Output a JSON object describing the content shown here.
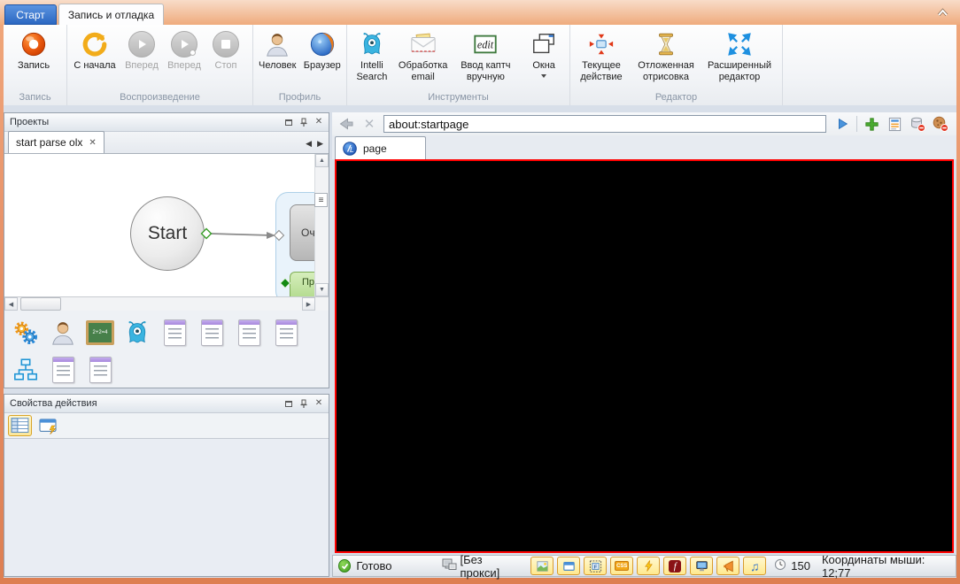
{
  "app_tabs": {
    "start": "Старт",
    "record_debug": "Запись и отладка"
  },
  "ribbon": {
    "groups": [
      {
        "label": "Запись",
        "buttons": [
          {
            "label": "Запись",
            "enabled": true
          }
        ]
      },
      {
        "label": "Воспроизведение",
        "buttons": [
          {
            "label": "С начала",
            "enabled": true
          },
          {
            "label": "Вперед",
            "enabled": false
          },
          {
            "label": "Вперед",
            "enabled": false
          },
          {
            "label": "Стоп",
            "enabled": false
          }
        ]
      },
      {
        "label": "Профиль",
        "buttons": [
          {
            "label": "Человек",
            "enabled": true
          },
          {
            "label": "Браузер",
            "enabled": true
          }
        ]
      },
      {
        "label": "Инструменты",
        "buttons": [
          {
            "label": "Intelli Search",
            "enabled": true
          },
          {
            "label": "Обработка email",
            "enabled": true
          },
          {
            "label": "Ввод каптч вручную",
            "enabled": true
          },
          {
            "label": "Окна",
            "enabled": true,
            "dropdown": true
          }
        ]
      },
      {
        "label": "Редактор",
        "buttons": [
          {
            "label": "Текущее действие",
            "enabled": true
          },
          {
            "label": "Отложенная отрисовка",
            "enabled": true
          },
          {
            "label": "Расширенный редактор",
            "enabled": true
          }
        ]
      }
    ]
  },
  "projects_panel": {
    "title": "Проекты",
    "doc_tab_label": "start parse olx",
    "flowchart": {
      "start_node": "Start",
      "gray_action": "Оч",
      "green_action": "Пр"
    }
  },
  "properties_panel": {
    "title": "Свойства действия"
  },
  "browser": {
    "url": "about:startpage",
    "page_tab": "page"
  },
  "statusbar": {
    "status": "Готово",
    "proxy": "[Без прокси]",
    "timer_value": "150",
    "mouse_coords": "Координаты мыши: 12;77"
  },
  "icons": {
    "record": "orange glossy donut",
    "restart": "gold circular arrow",
    "play": "gray circle with triangle",
    "play_step": "gray circle with triangle and dot",
    "stop": "gray circle with square",
    "person": "user silhouette",
    "browser": "firefox-like globe",
    "alien": "blue one-eyed creature",
    "email": "envelope with letter",
    "captcha": "edit scribble card",
    "windows": "two overlapping windows",
    "current_action": "blue rect with four red arrows inward",
    "hourglass": "golden hourglass",
    "expanded_editor": "four blue arrows outward",
    "gears": "orange and blue gears",
    "math_board_text": "2+2=4",
    "hierarchy": "blue org-chart",
    "document": "page with purple header and list lines",
    "property_grid": "table grid",
    "window_lightning": "window with lightning bolt",
    "toggles": [
      "picture",
      "window",
      "frame",
      "css",
      "lightning",
      "flash",
      "monitor",
      "horn",
      "music"
    ]
  },
  "colors": {
    "window_accent": "#e08554",
    "active_tab_blue": "#3374cd",
    "record_orange": "#e8590f",
    "selection_border_red": "#fe0000",
    "status_ok_green": "#56b430",
    "toggle_button_yellow": "#ffe98e"
  }
}
